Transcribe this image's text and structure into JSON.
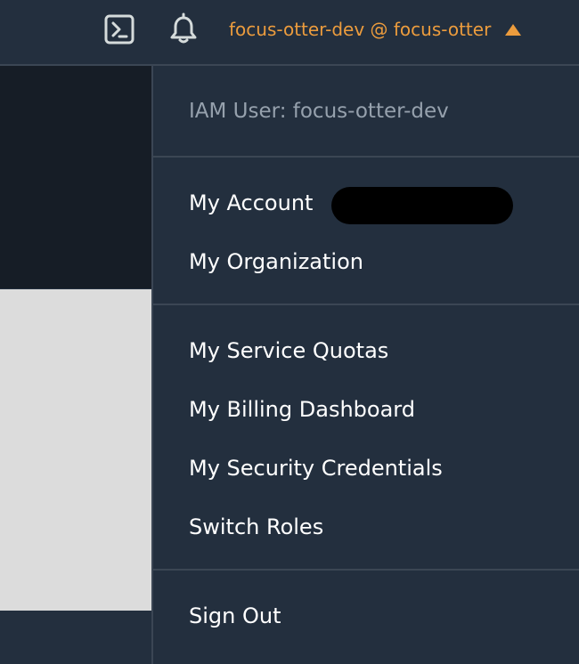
{
  "topbar": {
    "account_label": "focus-otter-dev @ focus-otter",
    "icons": [
      "cloudshell-icon",
      "bell-icon",
      "caret-up-icon"
    ],
    "accent_color": "#ec9c3d"
  },
  "dropdown": {
    "iam_user_label": "IAM User: focus-otter-dev",
    "items": {
      "my_account": "My Account",
      "my_organization": "My Organization",
      "my_service_quotas": "My Service Quotas",
      "my_billing_dashboard": "My Billing Dashboard",
      "my_security_credentials": "My Security Credentials",
      "switch_roles": "Switch Roles",
      "sign_out": "Sign Out"
    }
  }
}
